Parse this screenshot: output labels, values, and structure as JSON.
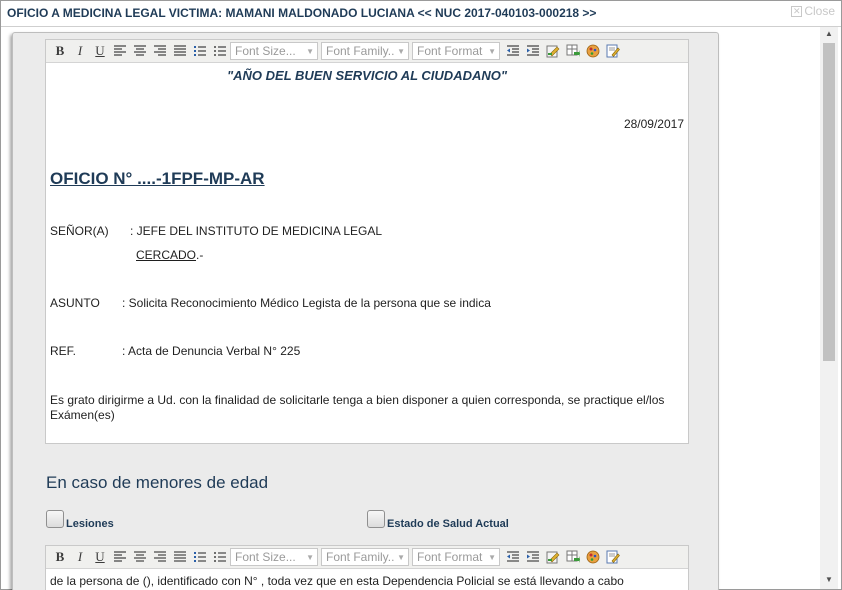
{
  "dialog": {
    "title": "OFICIO A MEDICINA LEGAL VICTIMA: MAMANI MALDONADO LUCIANA << NUC 2017-040103-000218 >>",
    "close_label": "Close"
  },
  "toolbar": {
    "bold": "B",
    "italic": "I",
    "underline": "U",
    "font_size_placeholder": "Font Size...",
    "font_family_placeholder": "Font Family..",
    "font_format_placeholder": "Font Format"
  },
  "document": {
    "motto": "\"AÑO DEL BUEN SERVICIO AL CIUDADANO\"",
    "date": "28/09/2017",
    "oficio_title": "OFICIO N° ....-1FPF-MP-AR",
    "senor_label": "SEÑOR(A)",
    "senor_value": ": JEFE DEL INSTITUTO DE MEDICINA LEGAL",
    "cercado": "CERCADO",
    "cercado_suffix": ".-",
    "asunto_label": "ASUNTO",
    "asunto_value": ": Solicita Reconocimiento Médico Legista de la persona que se indica",
    "ref_label": "REF.",
    "ref_value": ": Acta de Denuncia Verbal N° 225",
    "body_text": "Es grato dirigirme a Ud. con la finalidad de solicitarle tenga a bien disponer a quien corresponda, se practique el/los Exámen(es)"
  },
  "minors_section": {
    "title": "En caso de menores de edad",
    "checkbox_lesiones": "Lesiones",
    "checkbox_estado": "Estado de Salud Actual"
  },
  "second_editor": {
    "text": "de la persona de (), identificado con N° , toda vez que en esta Dependencia Policial se está llevando a cabo"
  },
  "colors": {
    "accent": "#1f3b57",
    "panel_bg": "#ebebeb",
    "toolbar_bg": "#f0f0ee"
  }
}
